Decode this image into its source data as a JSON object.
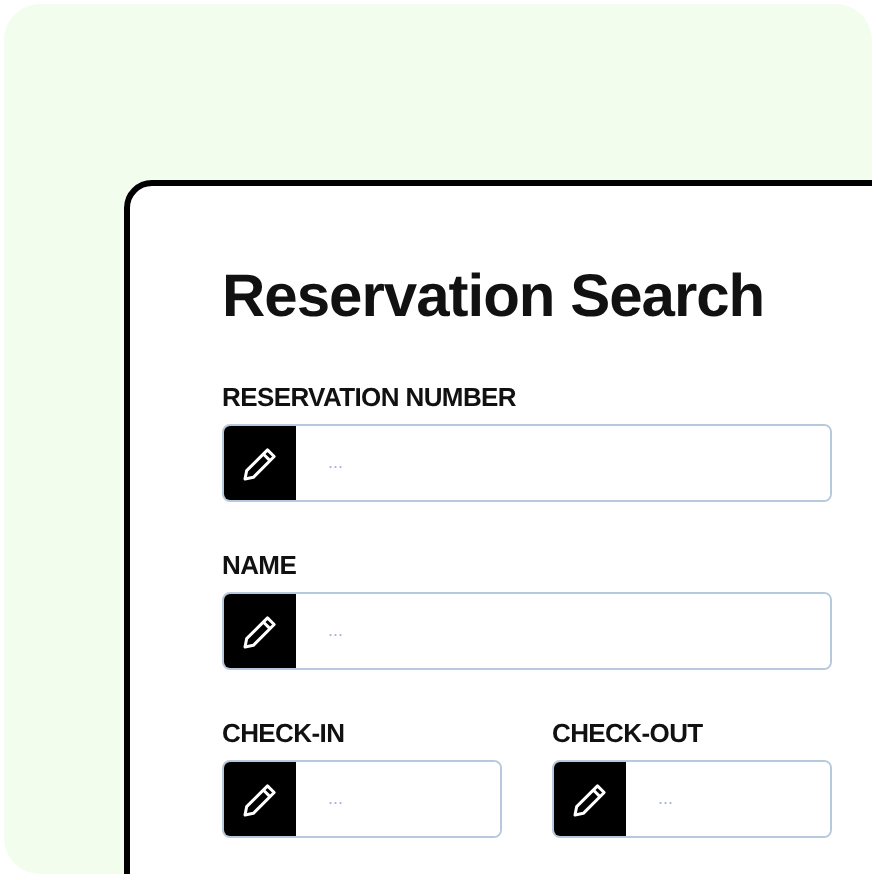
{
  "title": "Reservation Search",
  "rows": [
    [
      {
        "label": "RESERVATION NUMBER",
        "placeholder": "..."
      }
    ],
    [
      {
        "label": "NAME",
        "placeholder": "..."
      }
    ],
    [
      {
        "label": "CHECK-IN",
        "placeholder": "..."
      },
      {
        "label": "CHECK-OUT",
        "placeholder": "..."
      }
    ]
  ]
}
